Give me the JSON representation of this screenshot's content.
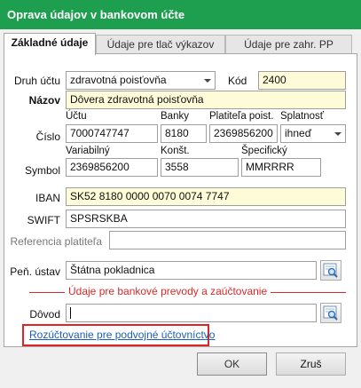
{
  "window": {
    "title": "Oprava údajov v bankovom účte"
  },
  "tabs": [
    {
      "label": "Základné údaje"
    },
    {
      "label": "Údaje pre tlač výkazov"
    },
    {
      "label": "Údaje pre zahr. PP"
    }
  ],
  "form": {
    "druh_uctu": {
      "label": "Druh účtu",
      "value": "zdravotná poisťovňa"
    },
    "kod": {
      "label": "Kód",
      "value": "2400"
    },
    "nazov": {
      "label": "Názov",
      "value": "Dôvera zdravotná poisťovňa"
    },
    "cislo": {
      "label": "Číslo",
      "uctu": {
        "header": "Účtu",
        "value": "7000747747"
      },
      "banky": {
        "header": "Banky",
        "value": "8180"
      },
      "platitela": {
        "header": "Platiteľa poist.",
        "value": "2369856200"
      },
      "splatnost": {
        "header": "Splatnosť",
        "value": "ihneď"
      }
    },
    "symbol": {
      "label": "Symbol",
      "variabilny": {
        "header": "Variabilný",
        "value": "2369856200"
      },
      "konst": {
        "header": "Konšt.",
        "value": "3558"
      },
      "specificky": {
        "header": "Špecifický",
        "value": "MMRRRR"
      }
    },
    "iban": {
      "label": "IBAN",
      "value": "SK52 8180 0000 0070 0074 7747"
    },
    "swift": {
      "label": "SWIFT",
      "value": "SPSRSKBA"
    },
    "referencia": {
      "label": "Referencia platiteľa",
      "value": ""
    },
    "pen_ustav": {
      "label": "Peň. ústav",
      "value": "Štátna pokladnica"
    },
    "section_title": "Údaje pre bankové prevody a zaúčtovanie",
    "dovod": {
      "label": "Dôvod",
      "value": ""
    },
    "link": "Rozúčtovanie pre podvojné účtovníctvo"
  },
  "buttons": {
    "ok": "OK",
    "cancel": "Zruš"
  },
  "colors": {
    "titlebar": "#1e9e4f",
    "required_field": "#fdfbd8",
    "accent_red": "#d62b2b",
    "link": "#1a5fb4"
  }
}
